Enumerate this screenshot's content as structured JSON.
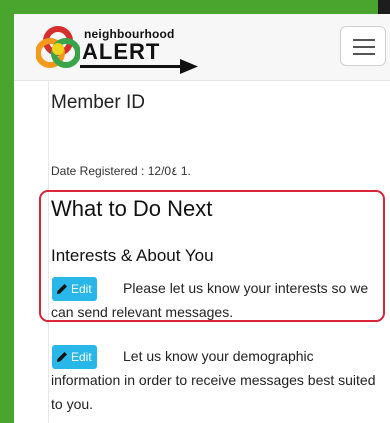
{
  "brand": {
    "line1": "neighbourhood",
    "line2": "ALERT",
    "colors": {
      "red": "#d62d2d",
      "orange": "#f39a1e",
      "yellow": "#f2d21b",
      "green": "#3aa548",
      "frame_green": "#4aa52e"
    }
  },
  "header": {
    "menu_icon": "hamburger-menu-icon"
  },
  "profile": {
    "member_id_label": "Member ID",
    "date_registered": "Date Registered : 12/0٤ 1."
  },
  "next_steps": {
    "title": "What to Do Next",
    "interests_title": "Interests & About You",
    "edit_label": "Edit",
    "interests_text": "Please let us know your interests so we can send relevant messages.",
    "demographic_text": "Let us know your demographic information in order to receive messages best suited to you.",
    "highlight_color": "#d9263b",
    "button_color": "#29b6e8"
  }
}
